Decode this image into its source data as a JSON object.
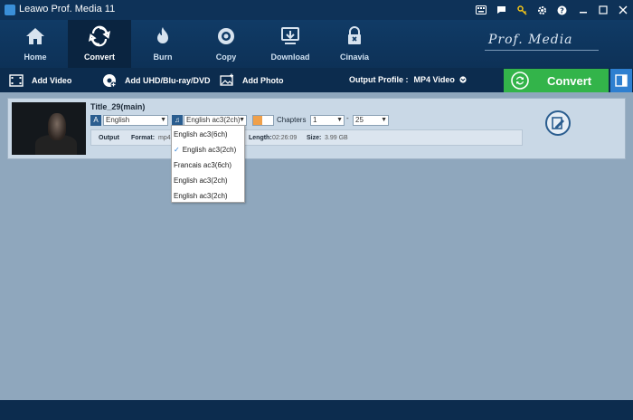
{
  "window": {
    "title": "Leawo Prof. Media 11"
  },
  "nav": {
    "items": [
      {
        "label": "Home",
        "icon": "house-icon"
      },
      {
        "label": "Convert",
        "icon": "convert-icon",
        "active": true
      },
      {
        "label": "Burn",
        "icon": "flame-icon"
      },
      {
        "label": "Copy",
        "icon": "disc-icon"
      },
      {
        "label": "Download",
        "icon": "download-icon"
      },
      {
        "label": "Cinavia",
        "icon": "lock-icon"
      }
    ],
    "brand": "Prof. Media"
  },
  "toolbar": {
    "add_video": "Add Video",
    "add_uhd": "Add UHD/Blu-ray/DVD",
    "add_photo": "Add Photo",
    "output_profile_label": "Output Profile :",
    "output_profile_value": "MP4 Video"
  },
  "convert_button": {
    "label": "Convert",
    "color": "#33b44a"
  },
  "title_item": {
    "name": "Title_29(main)",
    "subtitle_value": "English",
    "audio_value": "English ac3(2ch)",
    "chapters_label": "Chapters",
    "chapter_from": "1",
    "chapter_to": "25",
    "output": {
      "output_label": "Output",
      "format_label": "Format:",
      "format_value": "mp4",
      "length_label": "Length:",
      "length_value": "02:26:09",
      "size_label": "Size:",
      "size_value": "3.99 GB"
    }
  },
  "audio_dropdown": {
    "options": [
      {
        "label": "English ac3(6ch)",
        "checked": false
      },
      {
        "label": "English ac3(2ch)",
        "checked": true
      },
      {
        "label": "Francais ac3(6ch)",
        "checked": false
      },
      {
        "label": "English ac3(2ch)",
        "checked": false
      },
      {
        "label": "English ac3(2ch)",
        "checked": false
      }
    ]
  }
}
